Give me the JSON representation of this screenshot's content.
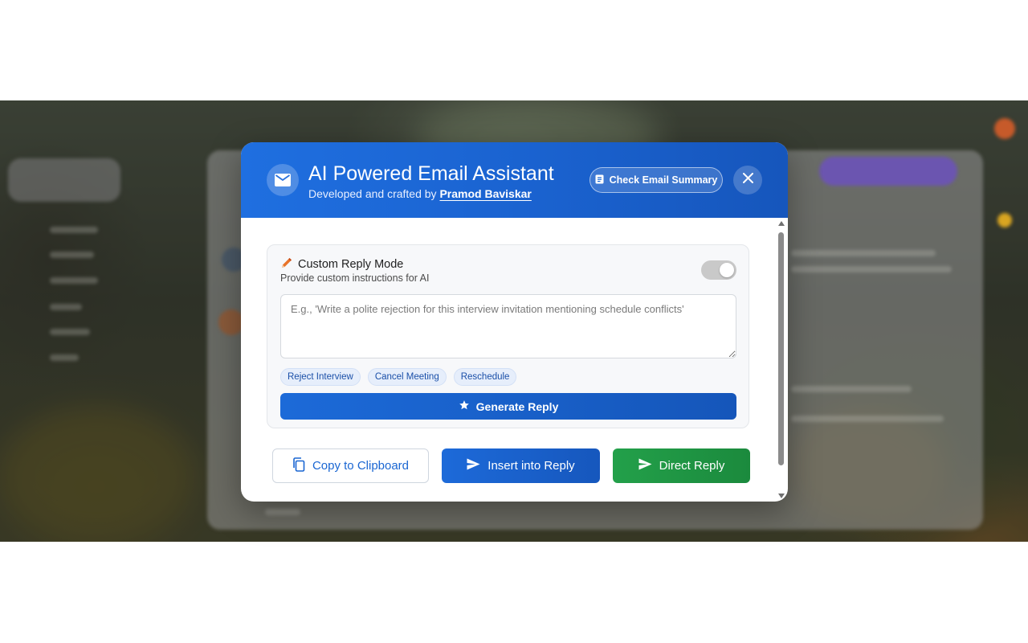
{
  "app": {
    "title": "AI Powered Email Assistant",
    "subtitle_prefix": "Developed and crafted by",
    "author": "Pramod Baviskar",
    "check_summary_label": "Check Email Summary",
    "icons": {
      "logo": "mail-icon",
      "summary": "document-icon",
      "close": "close-icon",
      "pencil": "pencil-icon",
      "star": "star-icon",
      "copy": "copy-icon",
      "send": "send-icon"
    }
  },
  "custom_reply": {
    "title": "Custom Reply Mode",
    "description": "Provide custom instructions for AI",
    "toggle_on": false,
    "input_value": "",
    "input_placeholder": "E.g., 'Write a polite rejection for this interview invitation mentioning schedule conflicts'",
    "chips": [
      "Reject Interview",
      "Cancel Meeting",
      "Reschedule"
    ],
    "generate_label": "Generate Reply"
  },
  "actions": {
    "copy_label": "Copy to Clipboard",
    "insert_label": "Insert into Reply",
    "direct_label": "Direct Reply"
  },
  "colors": {
    "header_blue": "#1f6fe0",
    "primary_blue": "#1c6ad8",
    "success_green": "#23a04a",
    "chip_bg": "#e6eefb",
    "pencil_orange": "#e8742a"
  }
}
